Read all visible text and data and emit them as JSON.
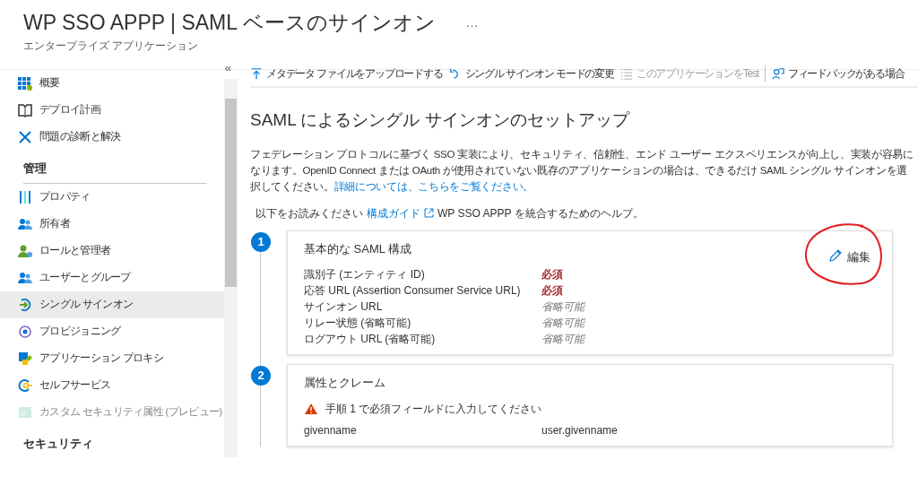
{
  "header": {
    "title": "WP SSO APPP | SAML ベースのサインオン",
    "more": "…",
    "subtitle": "エンタープライズ アプリケーション"
  },
  "sidebar": {
    "collapse": "«",
    "sections": [
      {
        "items": [
          {
            "label": "概要",
            "selected": false,
            "disabled": false
          },
          {
            "label": "デプロイ計画",
            "selected": false,
            "disabled": false
          },
          {
            "label": "問題の診断と解決",
            "selected": false,
            "disabled": false
          }
        ]
      },
      {
        "heading": "管理",
        "items": [
          {
            "label": "プロパティ",
            "selected": false,
            "disabled": false
          },
          {
            "label": "所有者",
            "selected": false,
            "disabled": false
          },
          {
            "label": "ロールと管理者",
            "selected": false,
            "disabled": false
          },
          {
            "label": "ユーザーとグループ",
            "selected": false,
            "disabled": false
          },
          {
            "label": "シングル サインオン",
            "selected": true,
            "disabled": false
          },
          {
            "label": "プロビジョニング",
            "selected": false,
            "disabled": false
          },
          {
            "label": "アプリケーション プロキシ",
            "selected": false,
            "disabled": false
          },
          {
            "label": "セルフサービス",
            "selected": false,
            "disabled": false
          },
          {
            "label": "カスタム セキュリティ属性 (プレビュー)",
            "selected": false,
            "disabled": true
          }
        ]
      },
      {
        "heading": "セキュリティ"
      }
    ]
  },
  "toolbar": [
    {
      "label": "メタデータ ファイルをアップロードする",
      "disabled": false
    },
    {
      "label": "シングル サインオン モードの変更",
      "disabled": false
    },
    {
      "label": "このアプリケーションをTest",
      "disabled": true
    },
    {
      "label": "フィードバックがある場合",
      "disabled": false
    }
  ],
  "main": {
    "title": "SAML によるシングル サインオンのセットアップ",
    "description": "フェデレーション プロトコルに基づく SSO 実装により、セキュリティ、信頼性、エンド ユーザー エクスペリエンスが向上し、実装が容易になります。OpenID Connect または OAuth が使用されていない既存のアプリケーションの場合は、できるだけ SAML シングル サインオンを選択してください。",
    "description_link": "詳細については、こちらをご覧ください。",
    "guide_prefix": "以下をお読みください",
    "guide_link": "構成ガイド",
    "guide_suffix": "WP SSO APPP を統合するためのヘルプ。",
    "steps": [
      {
        "number": "1",
        "title": "基本的な SAML 構成",
        "edit": "編集",
        "fields": [
          {
            "label": "識別子 (エンティティ ID)",
            "value": "必須",
            "kind": "required"
          },
          {
            "label": "応答 URL (Assertion Consumer Service URL)",
            "value": "必須",
            "kind": "required"
          },
          {
            "label": "サインオン URL",
            "value": "省略可能",
            "kind": "optional"
          },
          {
            "label": "リレー状態 (省略可能)",
            "value": "省略可能",
            "kind": "optional"
          },
          {
            "label": "ログアウト URL (省略可能)",
            "value": "省略可能",
            "kind": "optional"
          }
        ]
      },
      {
        "number": "2",
        "title": "属性とクレーム",
        "warning": "手順 1 で必須フィールドに入力してください",
        "fields": [
          {
            "label": "givenname",
            "value": "user.givenname",
            "kind": "plain"
          }
        ]
      }
    ]
  }
}
